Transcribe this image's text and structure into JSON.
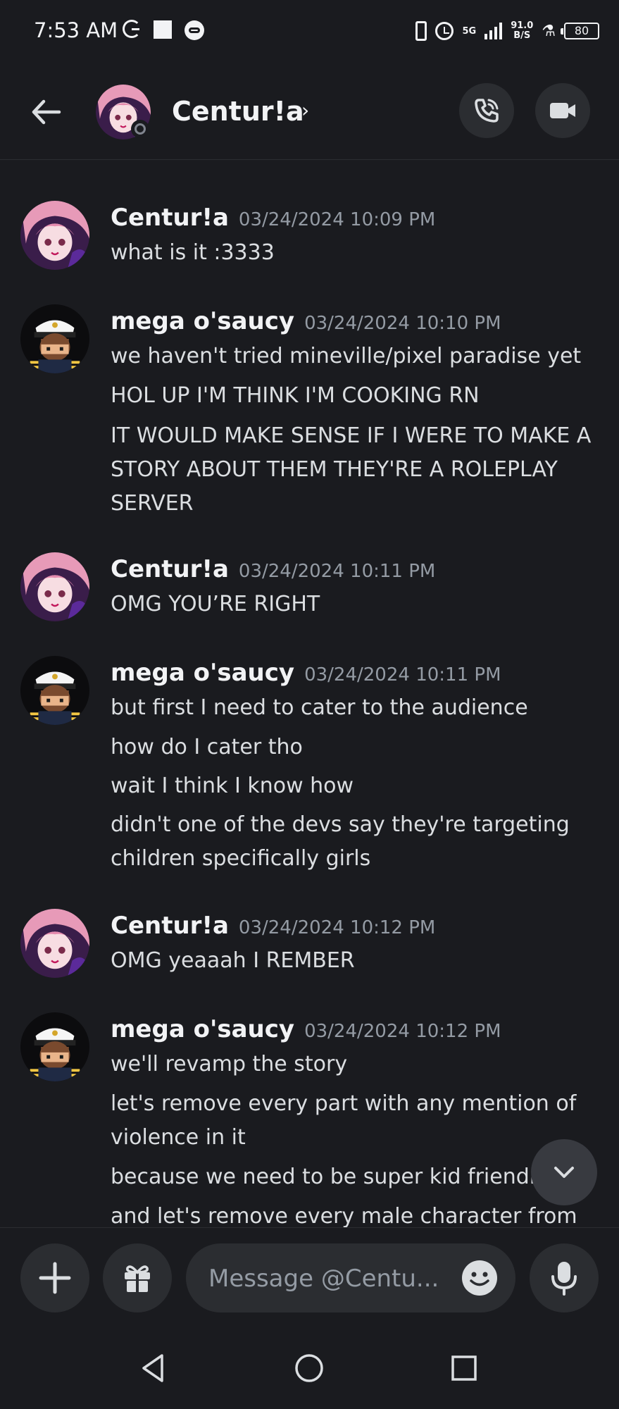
{
  "status_bar": {
    "time": "7:53 AM",
    "network": "5G",
    "speed_value": "91.0",
    "speed_unit": "B/S",
    "battery": "80"
  },
  "header": {
    "title": "Centur!a"
  },
  "messages": [
    {
      "author": "Centur!a",
      "timestamp": "03/24/2024 10:09 PM",
      "avatar": "pink-hair-anime-avatar",
      "lines": [
        "what is it :3333"
      ]
    },
    {
      "author": "mega o'saucy",
      "timestamp": "03/24/2024 10:10 PM",
      "avatar": "captain-hat-avatar",
      "lines": [
        "we haven't tried mineville/pixel paradise yet",
        "HOL UP I'M THINK I'M COOKING RN",
        "IT WOULD MAKE SENSE IF I WERE TO MAKE A",
        "STORY ABOUT THEM THEY'RE A ROLEPLAY",
        "SERVER"
      ]
    },
    {
      "author": "Centur!a",
      "timestamp": "03/24/2024 10:11 PM",
      "avatar": "pink-hair-anime-avatar",
      "lines": [
        "OMG YOU’RE RIGHT"
      ]
    },
    {
      "author": "mega o'saucy",
      "timestamp": "03/24/2024 10:11 PM",
      "avatar": "captain-hat-avatar",
      "lines": [
        "but first I need to cater to the audience",
        "how do I cater tho",
        "wait I think I know how",
        "didn't one of the devs say they're targeting",
        "children specifically girls"
      ]
    },
    {
      "author": "Centur!a",
      "timestamp": "03/24/2024 10:12 PM",
      "avatar": "pink-hair-anime-avatar",
      "lines": [
        "OMG yeaaah I REMBER"
      ]
    },
    {
      "author": "mega o'saucy",
      "timestamp": "03/24/2024 10:12 PM",
      "avatar": "captain-hat-avatar",
      "lines": [
        "we'll revamp the story",
        "let's remove every part with any mention of",
        "violence in it",
        "because we need to be super kid friendly",
        "and let's remove every male character from the"
      ]
    }
  ],
  "composer": {
    "placeholder": "Message @Centu..."
  },
  "icons": {
    "back": "arrow-left-icon",
    "call": "phone-call-icon",
    "video": "video-camera-icon",
    "add": "plus-icon",
    "gift": "gift-icon",
    "emoji": "emoji-icon",
    "mic": "microphone-icon",
    "scroll": "chevron-down-icon"
  },
  "colors": {
    "background": "#1a1b1f",
    "surface": "#2b2d31",
    "text": "#dbdee1",
    "muted": "#949ba4"
  }
}
